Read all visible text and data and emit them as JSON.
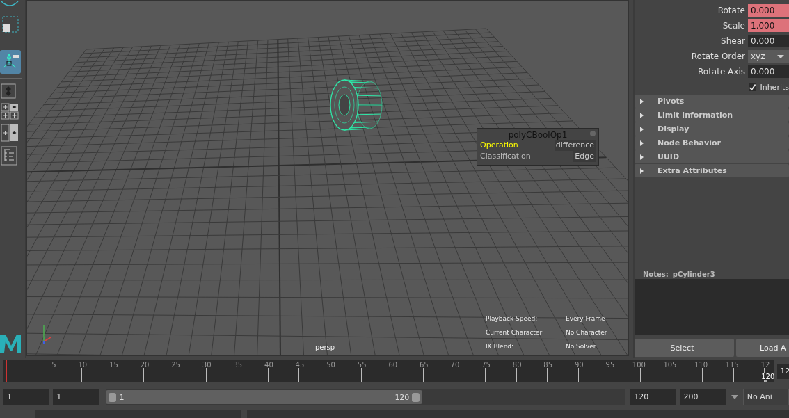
{
  "toolbar": {
    "tools": [
      {
        "kind": "lasso",
        "selected": false
      },
      {
        "kind": "region",
        "selected": false
      },
      {
        "kind": "manipulator",
        "selected": true
      }
    ]
  },
  "viewport": {
    "camera": "persp",
    "node_popup": {
      "title": "polyCBoolOp1",
      "rows": [
        {
          "label": "Operation",
          "value": "difference",
          "highlighted": true
        },
        {
          "label": "Classification",
          "value": "Edge",
          "highlighted": false
        }
      ]
    },
    "hud": [
      {
        "label": "Playback Speed:",
        "value": "Every Frame"
      },
      {
        "label": "Current Character:",
        "value": "No Character"
      },
      {
        "label": "IK Blend:",
        "value": "No Solver"
      }
    ]
  },
  "attributes": {
    "rows": [
      {
        "kind": "field",
        "label": "Rotate",
        "value": "0.000",
        "keyed": true
      },
      {
        "kind": "field",
        "label": "Scale",
        "value": "1.000",
        "keyed": true
      },
      {
        "kind": "field",
        "label": "Shear",
        "value": "0.000",
        "keyed": false
      },
      {
        "kind": "dropdown",
        "label": "Rotate Order",
        "value": "xyz"
      },
      {
        "kind": "field",
        "label": "Rotate Axis",
        "value": "0.000",
        "keyed": false
      }
    ],
    "inherits": {
      "label": "Inherits",
      "checked": true
    },
    "sections": [
      {
        "label": "Pivots",
        "expanded": false
      },
      {
        "label": "Limit Information",
        "expanded": false
      },
      {
        "label": "Display",
        "expanded": false
      },
      {
        "label": "Node Behavior",
        "expanded": false
      },
      {
        "label": "UUID",
        "expanded": false
      },
      {
        "label": "Extra Attributes",
        "expanded": false
      }
    ],
    "notes_label": "Notes:",
    "notes_node": "pCylinder3",
    "buttons": [
      "Select",
      "Load A"
    ]
  },
  "timeline": {
    "ticks": [
      "5",
      "10",
      "15",
      "20",
      "25",
      "30",
      "35",
      "40",
      "45",
      "50",
      "55",
      "60",
      "65",
      "70",
      "75",
      "80",
      "85",
      "90",
      "95",
      "100",
      "105",
      "110",
      "115",
      "12"
    ],
    "current_frame": "120",
    "frame_field": "12",
    "level": 1
  },
  "range": {
    "start": "1",
    "playback_start": "1",
    "slider_start": "1",
    "slider_end": "120",
    "level": 0.61,
    "playback_end": "120",
    "end": "200",
    "anim_layer": "No Ani"
  }
}
